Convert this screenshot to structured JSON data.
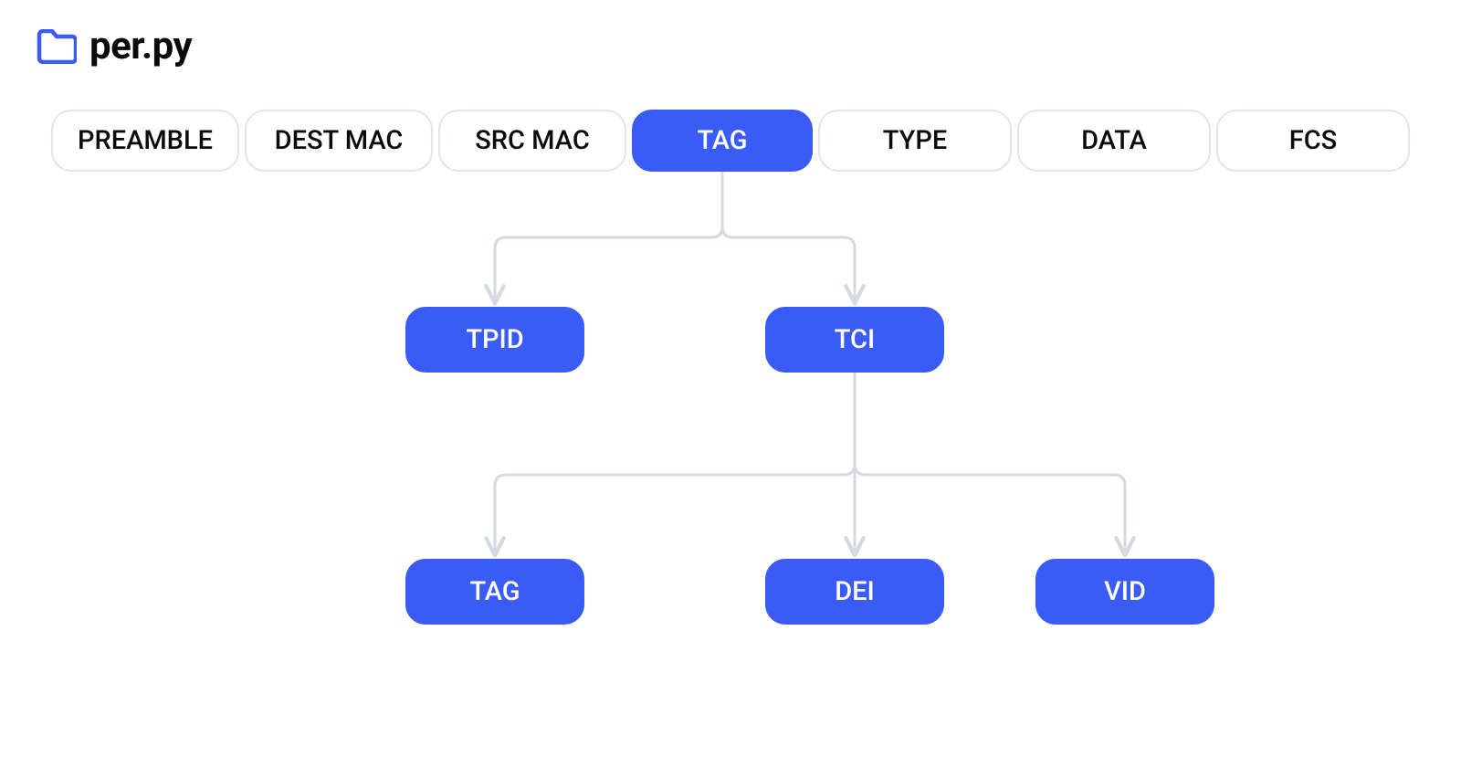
{
  "header": {
    "title": "per.py"
  },
  "frame": {
    "fields": [
      {
        "id": "preamble",
        "label": "PREAMBLE"
      },
      {
        "id": "destmac",
        "label": "DEST MAC"
      },
      {
        "id": "srcmac",
        "label": "SRC MAC"
      },
      {
        "id": "tag",
        "label": "TAG"
      },
      {
        "id": "type",
        "label": "TYPE"
      },
      {
        "id": "data",
        "label": "DATA"
      },
      {
        "id": "fcs",
        "label": "FCS"
      }
    ],
    "tag_children": [
      {
        "id": "tpid",
        "label": "TPID"
      },
      {
        "id": "tci",
        "label": "TCI"
      }
    ],
    "tci_children": [
      {
        "id": "tag2",
        "label": "TAG"
      },
      {
        "id": "dei",
        "label": "DEI"
      },
      {
        "id": "vid",
        "label": "VID"
      }
    ]
  },
  "colors": {
    "accent": "#3b5bf6",
    "outline": "#e2e5ea",
    "connector": "#d5d9e0",
    "text": "#0a0a0a"
  }
}
